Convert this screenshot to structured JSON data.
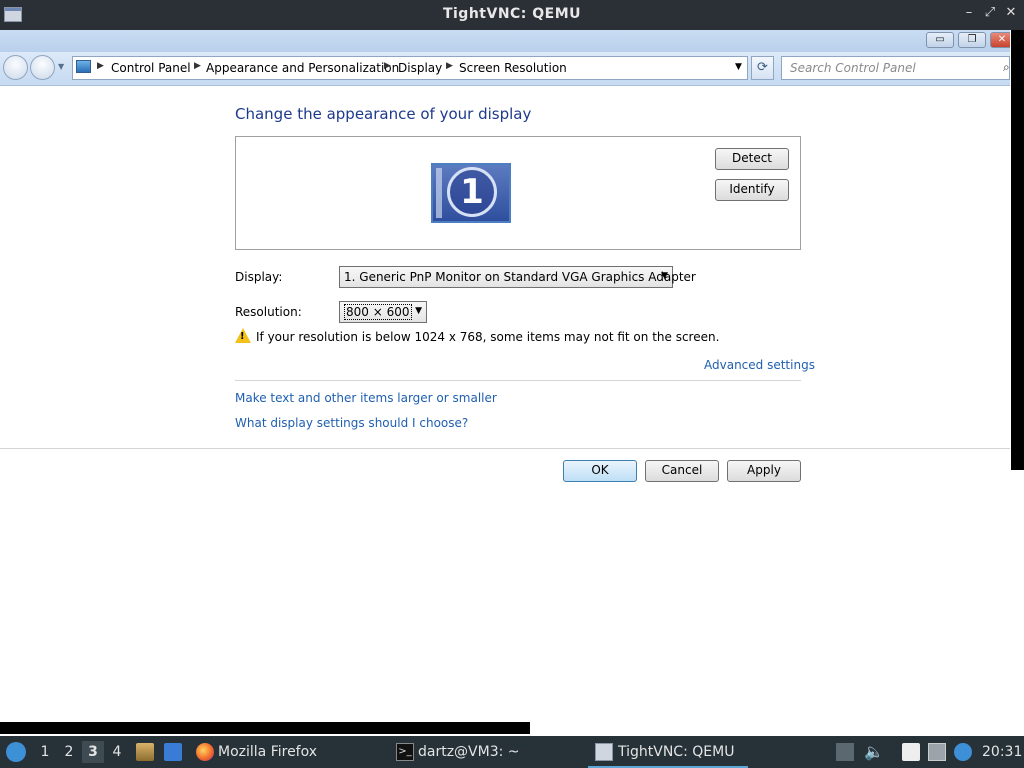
{
  "vnc": {
    "title": "TightVNC: QEMU",
    "controls": [
      "–",
      "⤢",
      "✕"
    ]
  },
  "window": {
    "caption_buttons": [
      "▭",
      "❐",
      "✕"
    ]
  },
  "nav": {
    "breadcrumbs": [
      "Control Panel",
      "Appearance and Personalization",
      "Display",
      "Screen Resolution"
    ],
    "search_placeholder": "Search Control Panel"
  },
  "page": {
    "heading": "Change the appearance of your display",
    "monitor_number": "1",
    "detect_label": "Detect",
    "identify_label": "Identify",
    "display_label": "Display:",
    "display_value": "1. Generic PnP Monitor on Standard VGA Graphics Adapter",
    "resolution_label": "Resolution:",
    "resolution_value": "800 × 600",
    "warning_text": "If your resolution is below 1024 x 768, some items may not fit on the screen.",
    "advanced_link": "Advanced settings",
    "link_text_size": "Make text and other items larger or smaller",
    "link_help": "What display settings should I choose?",
    "ok_label": "OK",
    "cancel_label": "Cancel",
    "apply_label": "Apply"
  },
  "taskbar": {
    "workspaces": [
      "1",
      "2",
      "3",
      "4"
    ],
    "active_workspace": "3",
    "tasks": [
      "Mozilla Firefox",
      "dartz@VM3: ~",
      "TightVNC: QEMU"
    ],
    "clock": "20:31"
  },
  "colors": {
    "link": "#1f5fb0",
    "heading": "#1e3a8c",
    "taskbar": "#263238"
  }
}
